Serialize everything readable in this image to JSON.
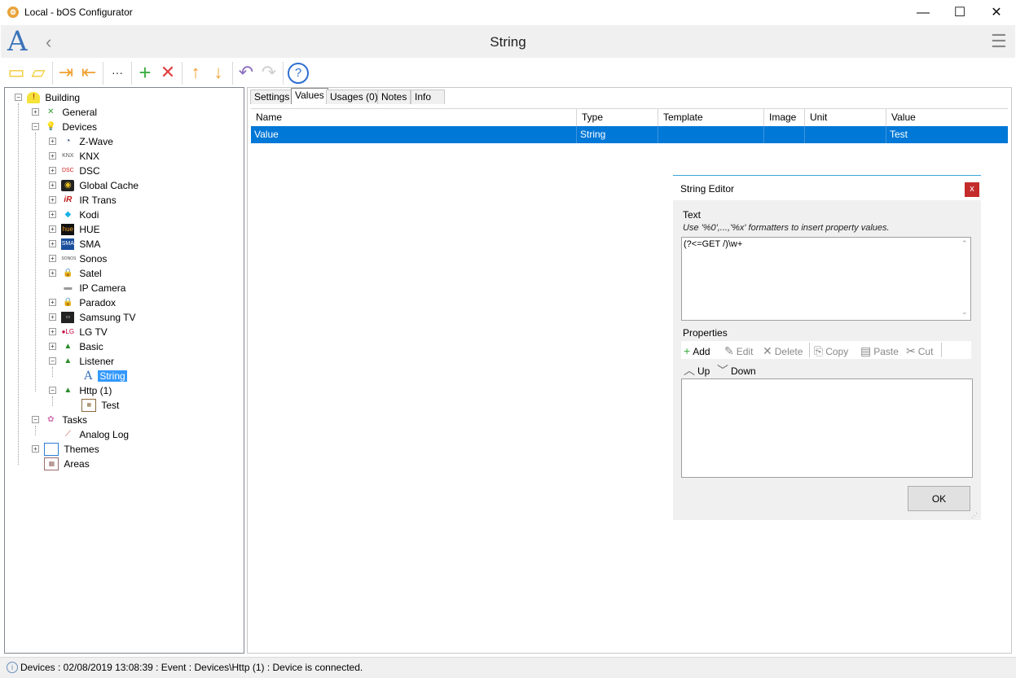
{
  "window": {
    "title": "Local - bOS Configurator",
    "minimize": "—",
    "maximize": "☐",
    "close": "✕"
  },
  "header": {
    "page_title": "String"
  },
  "toolbar": {
    "colors": {
      "yellow": "#f3c623",
      "orange": "#f0a030",
      "green": "#3cb043",
      "red": "#e04040",
      "purple": "#8a6fbf",
      "blue": "#2e6fd0"
    }
  },
  "tree": {
    "items": [
      {
        "label": "Building",
        "icon": "building-icon"
      },
      {
        "label": "General",
        "icon": "tools-icon"
      },
      {
        "label": "Devices",
        "icon": "lightbulb-icon"
      },
      {
        "label": "Z-Wave",
        "icon": "zwave-icon"
      },
      {
        "label": "KNX",
        "icon": "knx-icon"
      },
      {
        "label": "DSC",
        "icon": "dsc-icon"
      },
      {
        "label": "Global Cache",
        "icon": "global-cache-icon"
      },
      {
        "label": "IR Trans",
        "icon": "ir-trans-icon"
      },
      {
        "label": "Kodi",
        "icon": "kodi-icon"
      },
      {
        "label": "HUE",
        "icon": "hue-icon"
      },
      {
        "label": "SMA",
        "icon": "sma-icon"
      },
      {
        "label": "Sonos",
        "icon": "sonos-icon"
      },
      {
        "label": "Satel",
        "icon": "lock-icon"
      },
      {
        "label": "IP Camera",
        "icon": "camera-icon"
      },
      {
        "label": "Paradox",
        "icon": "lock-icon"
      },
      {
        "label": "Samsung TV",
        "icon": "tv-icon"
      },
      {
        "label": "LG TV",
        "icon": "lg-icon"
      },
      {
        "label": "Basic",
        "icon": "network-icon"
      },
      {
        "label": "Listener",
        "icon": "network-icon"
      },
      {
        "label": "String",
        "icon": "string-icon"
      },
      {
        "label": "Http (1)",
        "icon": "network-icon"
      },
      {
        "label": "Test",
        "icon": "device-icon"
      },
      {
        "label": "Tasks",
        "icon": "tasks-icon"
      },
      {
        "label": "Analog Log",
        "icon": "chart-icon"
      },
      {
        "label": "Themes",
        "icon": "monitor-icon"
      },
      {
        "label": "Areas",
        "icon": "areas-icon"
      }
    ]
  },
  "tabs": [
    "Settings",
    "Values",
    "Usages (0)",
    "Notes",
    "Info"
  ],
  "grid": {
    "columns": [
      "Name",
      "Type",
      "Template",
      "Image",
      "Unit",
      "Value"
    ],
    "row": {
      "name": "Value",
      "type": "String",
      "template": "",
      "image": "",
      "unit": "",
      "value": "Test"
    }
  },
  "dialog": {
    "title": "String Editor",
    "close": "x",
    "text_label": "Text",
    "text_hint": "Use '%0',...,'%x' formatters to insert property values.",
    "text_value": "(?<=GET /)\\w+",
    "properties_label": "Properties",
    "buttons": {
      "add": "Add",
      "edit": "Edit",
      "delete": "Delete",
      "copy": "Copy",
      "paste": "Paste",
      "cut": "Cut",
      "up": "Up",
      "down": "Down"
    },
    "ok": "OK"
  },
  "status": {
    "text": "Devices : 02/08/2019 13:08:39 : Event : Devices\\Http (1) : Device is connected."
  }
}
